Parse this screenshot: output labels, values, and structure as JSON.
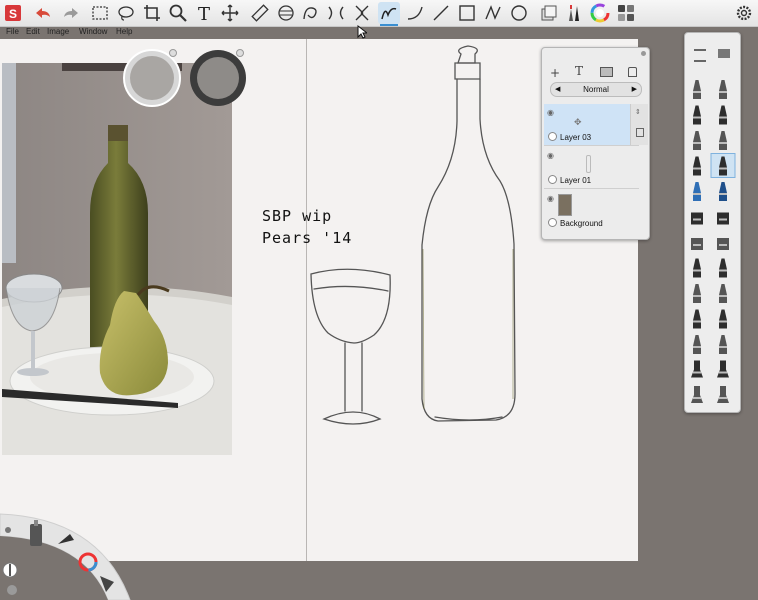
{
  "menu": {
    "file": "File",
    "edit": "Edit",
    "image": "Image",
    "window": "Window",
    "help": "Help"
  },
  "sketch_note": {
    "line1": "SBP wip",
    "line2": "Pears '14"
  },
  "layers": {
    "blend_mode": "Normal",
    "items": [
      {
        "name": "Layer 03",
        "selected": true
      },
      {
        "name": "Layer 01",
        "selected": false
      },
      {
        "name": "Background",
        "selected": false
      }
    ]
  },
  "colors": {
    "canvas": "#f4f2f1",
    "workspace": "#7a7470",
    "accent": "#3a8fd1",
    "logo": "#d8383a"
  }
}
